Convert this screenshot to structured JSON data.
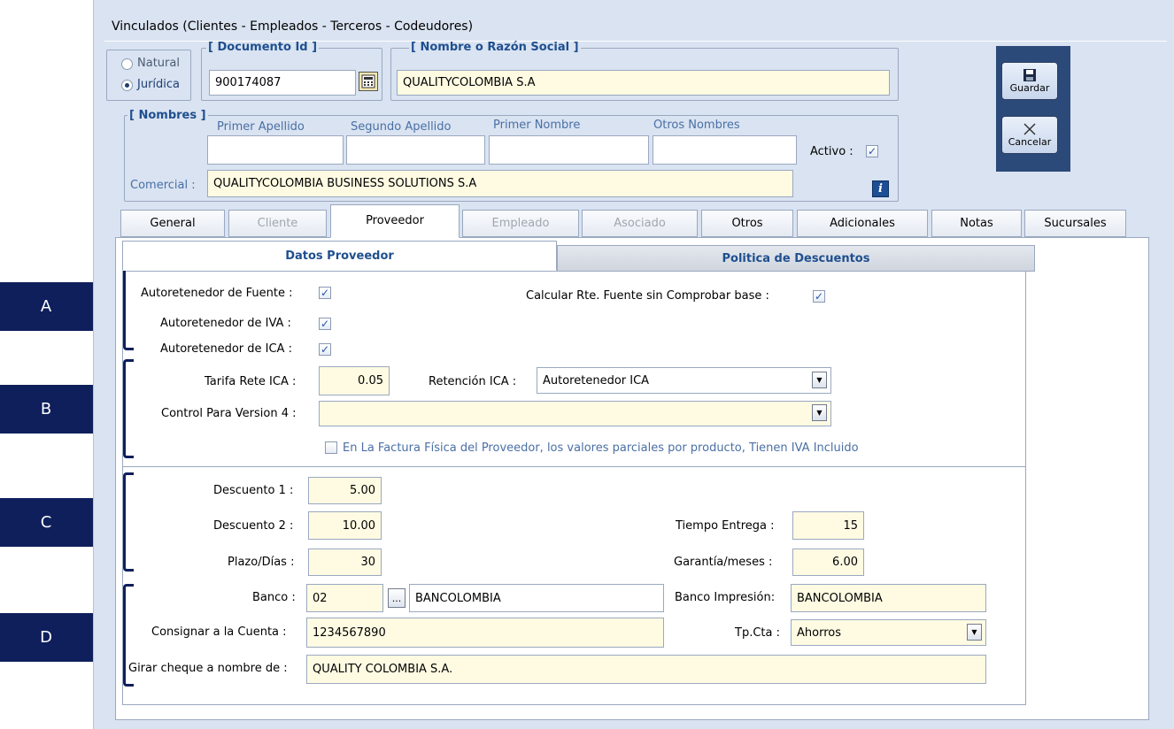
{
  "window": {
    "title": "Vinculados   (Clientes - Empleados - Terceros - Codeudores)"
  },
  "person_type": {
    "natural": "Natural",
    "juridica": "Jurídica",
    "selected": "juridica"
  },
  "documento": {
    "legend": "[ Documento Id ]",
    "value": "900174087"
  },
  "nombre": {
    "legend": "[ Nombre o Razón Social ]",
    "value": "QUALITYCOLOMBIA S.A"
  },
  "nombres": {
    "legend": "[ Nombres ]",
    "primer_apellido": "Primer Apellido",
    "segundo_apellido": "Segundo Apellido",
    "primer_nombre": "Primer Nombre",
    "otros_nombres": "Otros Nombres",
    "activo_label": "Activo :",
    "comercial_label": "Comercial :",
    "comercial_value": "QUALITYCOLOMBIA BUSINESS SOLUTIONS S.A"
  },
  "toolbar": {
    "guardar": "Guardar",
    "cancelar": "Cancelar"
  },
  "tabs": [
    "General",
    "Cliente",
    "Proveedor",
    "Empleado",
    "Asociado",
    "Otros",
    "Adicionales",
    "Notas",
    "Sucursales"
  ],
  "subtabs": {
    "datos": "Datos Proveedor",
    "politica": "Politica de Descuentos"
  },
  "section_a": {
    "fuente": "Autoretenedor de Fuente :",
    "iva": "Autoretenedor de IVA :",
    "ica": "Autoretenedor de ICA :",
    "calcular": "Calcular Rte. Fuente sin Comprobar base :"
  },
  "section_b": {
    "tarifa_label": "Tarifa Rete ICA :",
    "tarifa_value": "0.05",
    "retencion_label": "Retención ICA :",
    "retencion_value": "Autoretenedor ICA",
    "control_label": "Control Para Version 4 :",
    "control_value": "",
    "iva_incluido": "En La Factura Física del Proveedor, los valores parciales  por producto, Tienen IVA Incluido"
  },
  "section_c": {
    "desc1_label": "Descuento 1 :",
    "desc1_value": "5.00",
    "desc2_label": "Descuento 2 :",
    "desc2_value": "10.00",
    "plazo_label": "Plazo/Días :",
    "plazo_value": "30",
    "tiempo_label": "Tiempo Entrega :",
    "tiempo_value": "15",
    "garantia_label": "Garantía/meses :",
    "garantia_value": "6.00"
  },
  "section_d": {
    "banco_label": "Banco :",
    "banco_code": "02",
    "banco_browse": "...",
    "banco_name": "BANCOLOMBIA",
    "impresion_label": "Banco Impresión:",
    "impresion_value": "BANCOLOMBIA",
    "cuenta_label": "Consignar a la Cuenta :",
    "cuenta_value": "1234567890",
    "tpcta_label": "Tp.Cta :",
    "tpcta_value": "Ahorros",
    "cheque_label": "Girar cheque a nombre de :",
    "cheque_value": "QUALITY COLOMBIA S.A."
  },
  "callouts": [
    "A",
    "B",
    "C",
    "D"
  ],
  "colors": {
    "callout": "#0f1f5c",
    "field_bg": "#fffbe3",
    "window_bg": "#d9e3f1",
    "legend": "#1f4f8f"
  }
}
